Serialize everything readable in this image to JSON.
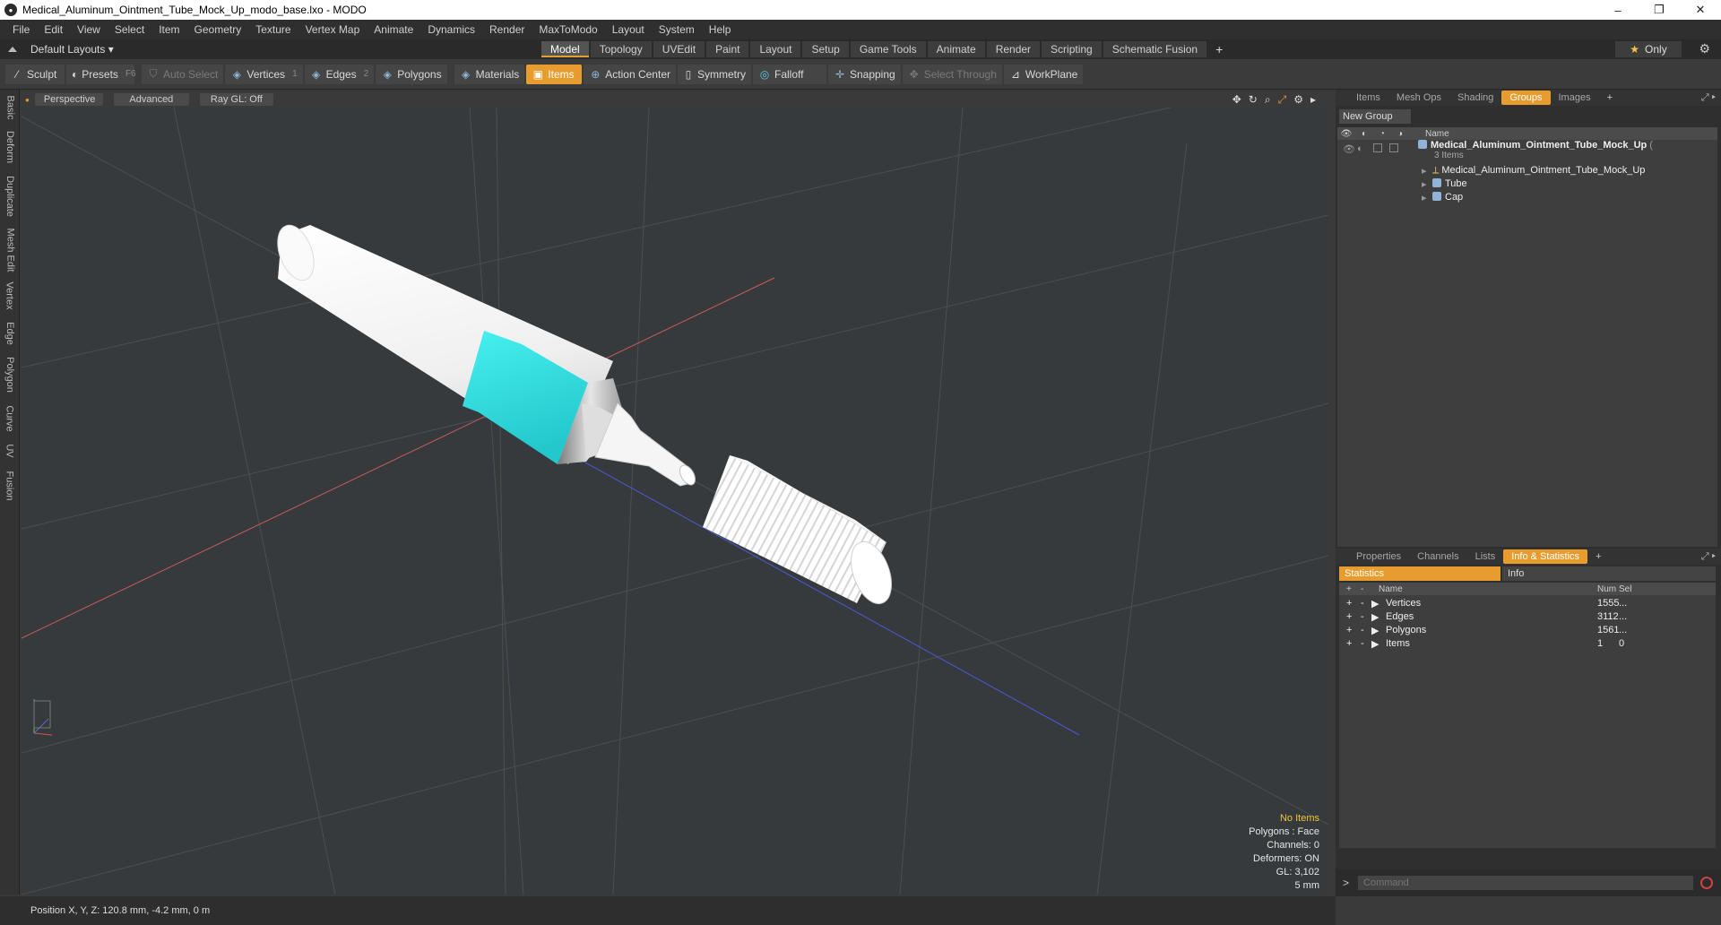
{
  "window": {
    "title": "Medical_Aluminum_Ointment_Tube_Mock_Up_modo_base.lxo - MODO",
    "app_icon": "modo-logo-icon",
    "minimize": "–",
    "maximize": "❐",
    "close": "✕"
  },
  "menu": [
    "File",
    "Edit",
    "View",
    "Select",
    "Item",
    "Geometry",
    "Texture",
    "Vertex Map",
    "Animate",
    "Dynamics",
    "Render",
    "MaxToModo",
    "Layout",
    "System",
    "Help"
  ],
  "layout_bar": {
    "layout_selector": "Default Layouts ▾",
    "tabs": [
      "Model",
      "Topology",
      "UVEdit",
      "Paint",
      "Layout",
      "Setup",
      "Game Tools",
      "Animate",
      "Render",
      "Scripting",
      "Schematic Fusion"
    ],
    "active_tab": "Model",
    "add_tab": "+",
    "only_label": "Only"
  },
  "toolbar": {
    "sculpt": "Sculpt",
    "presets": "Presets",
    "presets_shortcut": "F6",
    "auto_select": "Auto Select",
    "vertices": "Vertices",
    "vertices_shortcut": "1",
    "edges": "Edges",
    "edges_shortcut": "2",
    "polygons": "Polygons",
    "materials": "Materials",
    "items": "Items",
    "action_center": "Action Center",
    "symmetry": "Symmetry",
    "falloff": "Falloff",
    "snapping": "Snapping",
    "select_through": "Select Through",
    "workplane": "WorkPlane"
  },
  "left_tabs": [
    "Basic",
    "Deform",
    "Duplicate",
    "Mesh Edit",
    "Vertex",
    "Edge",
    "Polygon",
    "Curve",
    "UV",
    "Fusion"
  ],
  "viewport": {
    "perspective": "Perspective",
    "advanced": "Advanced",
    "ray_gl": "Ray GL: Off",
    "info": {
      "no_items": "No Items",
      "polygons": "Polygons : Face",
      "channels": "Channels: 0",
      "deformers": "Deformers: ON",
      "gl": "GL: 3,102",
      "scale": "5 mm"
    }
  },
  "status": {
    "position": "Position X, Y, Z:   120.8 mm, -4.2 mm, 0 m"
  },
  "groups_panel": {
    "tabs": [
      "Items",
      "Mesh Ops",
      "Shading",
      "Groups",
      "Images"
    ],
    "active_tab": "Groups",
    "new_group": "New Group",
    "name_header": "Name",
    "root": {
      "name": "Medical_Aluminum_Ointment_Tube_Mock_Up",
      "suffix": "(",
      "count": "3 Items"
    },
    "children": [
      "Medical_Aluminum_Ointment_Tube_Mock_Up",
      "Tube",
      "Cap"
    ]
  },
  "stats_panel": {
    "tabs": [
      "Properties",
      "Channels",
      "Lists",
      "Info & Statistics"
    ],
    "active_tab": "Info & Statistics",
    "switch": {
      "statistics": "Statistics",
      "info": "Info"
    },
    "headers": {
      "name": "Name",
      "num": "Num",
      "sel": "Sel"
    },
    "rows": [
      {
        "name": "Vertices",
        "num": "1555",
        "sel": "..."
      },
      {
        "name": "Edges",
        "num": "3112",
        "sel": "..."
      },
      {
        "name": "Polygons",
        "num": "1561",
        "sel": "..."
      },
      {
        "name": "Items",
        "num": "1",
        "sel": "0"
      }
    ]
  },
  "command": {
    "prompt": ">",
    "placeholder": "Command"
  },
  "colors": {
    "accent": "#e89c2e",
    "tube_band": "#38e6e6",
    "viewport_bg": "#363a3d"
  }
}
